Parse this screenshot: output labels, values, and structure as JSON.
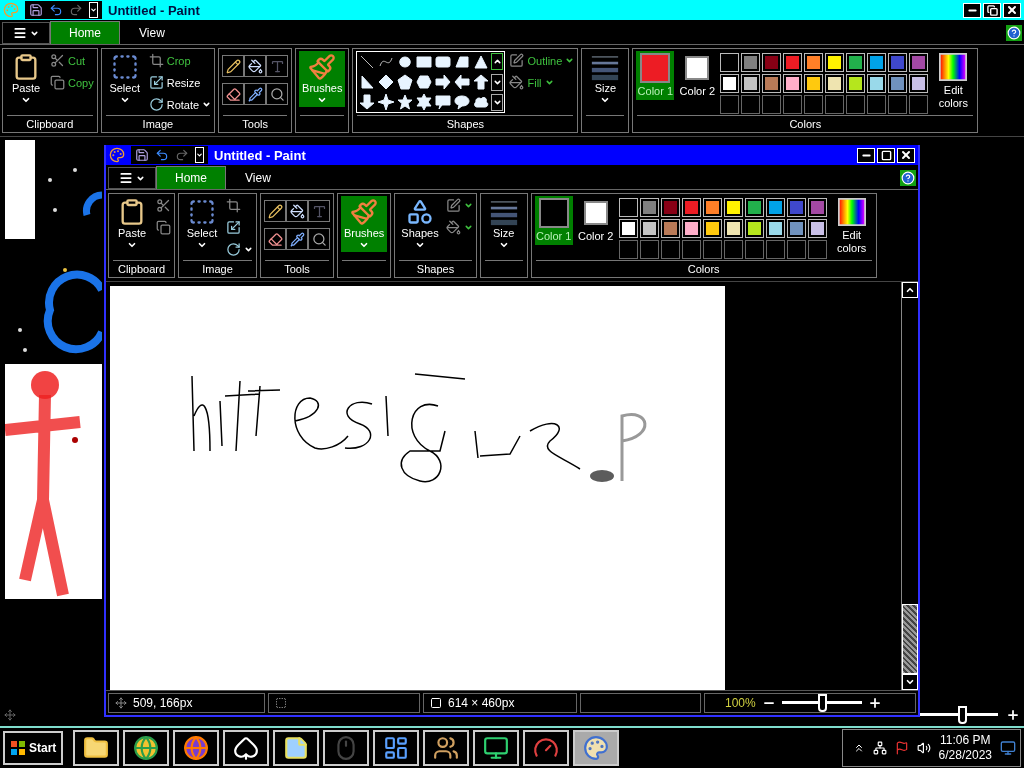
{
  "outer_window": {
    "title": "Untitled - Paint",
    "active": false,
    "maximized": true,
    "tabs": [
      {
        "label": "Home",
        "selected": true
      },
      {
        "label": "View",
        "selected": false
      }
    ],
    "ribbon": [
      {
        "kind": "clipboard",
        "label": "Clipboard",
        "big": {
          "kind": "paste",
          "label": "Paste",
          "selected": false
        },
        "small": [
          {
            "kind": "cut",
            "label": "Cut",
            "disabled": true
          },
          {
            "kind": "copy",
            "label": "Copy",
            "disabled": true
          }
        ]
      },
      {
        "label": "Image",
        "big": {
          "kind": "select",
          "label": "Select",
          "selected": false
        },
        "small": [
          {
            "kind": "crop",
            "label": "Crop",
            "disabled": true
          },
          {
            "kind": "resize",
            "label": "Resize",
            "disabled": false
          },
          {
            "kind": "rotate",
            "label": "Rotate",
            "disabled": false
          }
        ]
      },
      {
        "kind": "tools",
        "label": "Tools"
      },
      {
        "kind": "brushes",
        "big": {
          "kind": "brushes",
          "label": "Brushes",
          "selected": true
        }
      },
      {
        "kind": "gallery",
        "label": "Shapes",
        "small": [
          {
            "kind": "outline",
            "label": "Outline",
            "disabled": true
          },
          {
            "kind": "fill",
            "label": "Fill",
            "disabled": true
          }
        ]
      },
      {
        "kind": "size",
        "big": {
          "kind": "size",
          "label": "Size",
          "selected": false
        }
      },
      {
        "kind": "colors",
        "label": "Colors",
        "color1": {
          "label": "Color 1",
          "color": "#ed1c24",
          "selected": true
        },
        "color2": {
          "label": "Color 2",
          "color": "#ffffff",
          "selected": false
        },
        "edit": "Edit colors",
        "palette": [
          {
            "color": "#000000"
          },
          {
            "color": "#7f7f7f"
          },
          {
            "color": "#880015"
          },
          {
            "color": "#ed1c24"
          },
          {
            "color": "#ff7f27"
          },
          {
            "color": "#fff200"
          },
          {
            "color": "#22b14c"
          },
          {
            "color": "#00a2e8"
          },
          {
            "color": "#3f48cc"
          },
          {
            "color": "#a349a4"
          },
          {
            "color": "#ffffff"
          },
          {
            "color": "#c3c3c3"
          },
          {
            "color": "#b97a57"
          },
          {
            "color": "#ffaec9"
          },
          {
            "color": "#ffc90e"
          },
          {
            "color": "#efe4b0"
          },
          {
            "color": "#b5e61d"
          },
          {
            "color": "#99d9ea"
          },
          {
            "color": "#7092be"
          },
          {
            "color": "#c8bfe7"
          }
        ]
      }
    ],
    "status_bar": {
      "zoom_slider": {
        "level": 0.55
      }
    }
  },
  "inner_window": {
    "title": "Untitled - Paint",
    "active": true,
    "maximized": false,
    "tabs": [
      {
        "label": "Home",
        "selected": true
      },
      {
        "label": "View",
        "selected": false
      }
    ],
    "ribbon": [
      {
        "kind": "clipboard",
        "label": "Clipboard",
        "big": {
          "kind": "paste",
          "label": "Paste",
          "selected": false
        },
        "small": [
          {
            "kind": "cut",
            "disabled": true
          },
          {
            "kind": "copy",
            "disabled": true
          }
        ]
      },
      {
        "label": "Image",
        "big": {
          "kind": "select",
          "label": "Select",
          "selected": false
        },
        "small": [
          {
            "kind": "crop",
            "disabled": true
          },
          {
            "kind": "resize",
            "disabled": false
          },
          {
            "kind": "rotate",
            "disabled": false
          }
        ]
      },
      {
        "kind": "tools",
        "label": "Tools"
      },
      {
        "kind": "brushes",
        "big": {
          "kind": "brushes",
          "label": "Brushes",
          "selected": true
        }
      },
      {
        "kind": "shapes",
        "label": "Shapes",
        "big": {
          "kind": "shapes",
          "label": "Shapes",
          "selected": false
        },
        "small": [
          {
            "kind": "outline",
            "disabled": true
          },
          {
            "kind": "fill",
            "disabled": true
          }
        ]
      },
      {
        "kind": "size",
        "big": {
          "kind": "size",
          "label": "Size",
          "selected": false
        }
      },
      {
        "kind": "colors",
        "label": "Colors",
        "color1": {
          "label": "Color 1",
          "color": "#000000",
          "selected": true
        },
        "color2": {
          "label": "Color 2",
          "color": "#ffffff",
          "selected": false
        },
        "edit": "Edit colors",
        "palette": [
          {
            "color": "#000000"
          },
          {
            "color": "#7f7f7f"
          },
          {
            "color": "#880015"
          },
          {
            "color": "#ed1c24"
          },
          {
            "color": "#ff7f27"
          },
          {
            "color": "#fff200"
          },
          {
            "color": "#22b14c"
          },
          {
            "color": "#00a2e8"
          },
          {
            "color": "#3f48cc"
          },
          {
            "color": "#a349a4"
          },
          {
            "color": "#ffffff"
          },
          {
            "color": "#c3c3c3"
          },
          {
            "color": "#b97a57"
          },
          {
            "color": "#ffaec9"
          },
          {
            "color": "#ffc90e"
          },
          {
            "color": "#efe4b0"
          },
          {
            "color": "#b5e61d"
          },
          {
            "color": "#99d9ea"
          },
          {
            "color": "#7092be"
          },
          {
            "color": "#c8bfe7"
          }
        ]
      }
    ],
    "canvas": {
      "kind": "scribble"
    },
    "status_bar": {
      "cursor": "509, 166px",
      "canvas_size": "614 × 460px",
      "zoom": "100%",
      "zoom_slider": {
        "level": 0.5
      }
    }
  },
  "taskbar": {
    "start": "Start",
    "apps": [
      {
        "kind": "folder",
        "selected": false
      },
      {
        "kind": "chrome",
        "selected": false
      },
      {
        "kind": "firefox",
        "selected": false
      },
      {
        "kind": "cards",
        "selected": false
      },
      {
        "kind": "notes",
        "selected": false
      },
      {
        "kind": "mouse",
        "selected": false
      },
      {
        "kind": "dashboard",
        "selected": false
      },
      {
        "kind": "users",
        "selected": false
      },
      {
        "kind": "monitor",
        "selected": false
      },
      {
        "kind": "gauge",
        "selected": false
      },
      {
        "kind": "paint",
        "selected": true
      }
    ],
    "clock": {
      "time": "11:06 PM",
      "date": "6/28/2023"
    }
  }
}
